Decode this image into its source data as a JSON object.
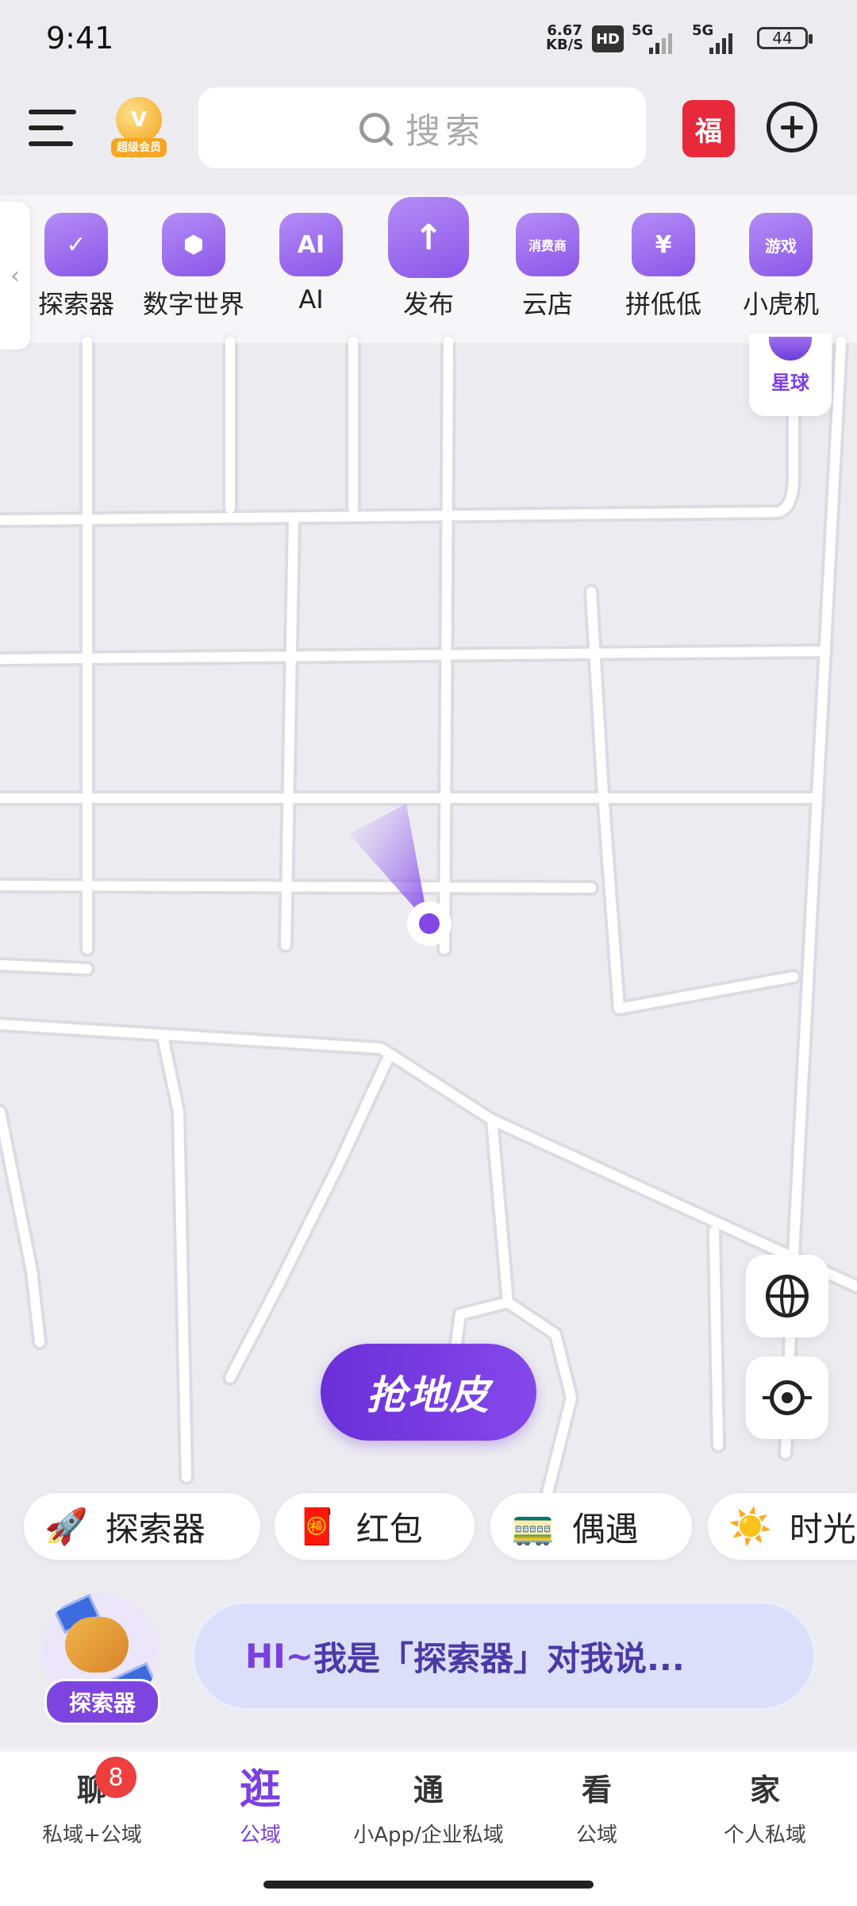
{
  "status": {
    "time": "9:41",
    "speed_value": "6.67",
    "speed_unit": "KB/S",
    "hd": "HD",
    "net1": "5G",
    "net2": "5G",
    "battery": "44"
  },
  "header": {
    "search_placeholder": "搜索",
    "vip_badge": "V",
    "vip_label": "超级会员",
    "redpacket_glyph": "福"
  },
  "features": [
    {
      "label": "探索器",
      "icon": "check-swoosh-icon"
    },
    {
      "label": "数字世界",
      "icon": "cube-icon"
    },
    {
      "label": "AI",
      "icon": "ai-person-icon",
      "glyph": "AI"
    },
    {
      "label": "发布",
      "icon": "arrow-up-icon",
      "glyph": "↑"
    },
    {
      "label": "云店",
      "icon": "consumer-icon",
      "glyph": "消费商"
    },
    {
      "label": "拼低低",
      "icon": "tornado-icon",
      "glyph": "¥"
    },
    {
      "label": "小虎机",
      "icon": "slot-machine-icon",
      "glyph": "游戏"
    }
  ],
  "planet": {
    "label": "星球"
  },
  "map": {
    "grab_label": "抢地皮"
  },
  "chips": [
    {
      "emoji": "🚀",
      "label": "探索器"
    },
    {
      "emoji": "🧧",
      "label": "红包"
    },
    {
      "emoji": "🚃",
      "label": "偶遇"
    },
    {
      "emoji": "☀️",
      "label": "时光"
    }
  ],
  "assistant": {
    "tag": "探索器",
    "greeting_hi": "HI~",
    "greeting_rest": "我是「探索器」对我说..."
  },
  "nav": {
    "badge": "8",
    "items": [
      {
        "big": "聊",
        "small": "私域+公域"
      },
      {
        "big": "逛",
        "small": "公域"
      },
      {
        "big": "通",
        "small": "小App/企业私域"
      },
      {
        "big": "看",
        "small": "公域"
      },
      {
        "big": "家",
        "small": "个人私域"
      }
    ]
  },
  "colors": {
    "accent": "#7b3fe4",
    "map_bg": "#ececf0",
    "road": "#ffffff",
    "badge": "#ee3e3e"
  }
}
